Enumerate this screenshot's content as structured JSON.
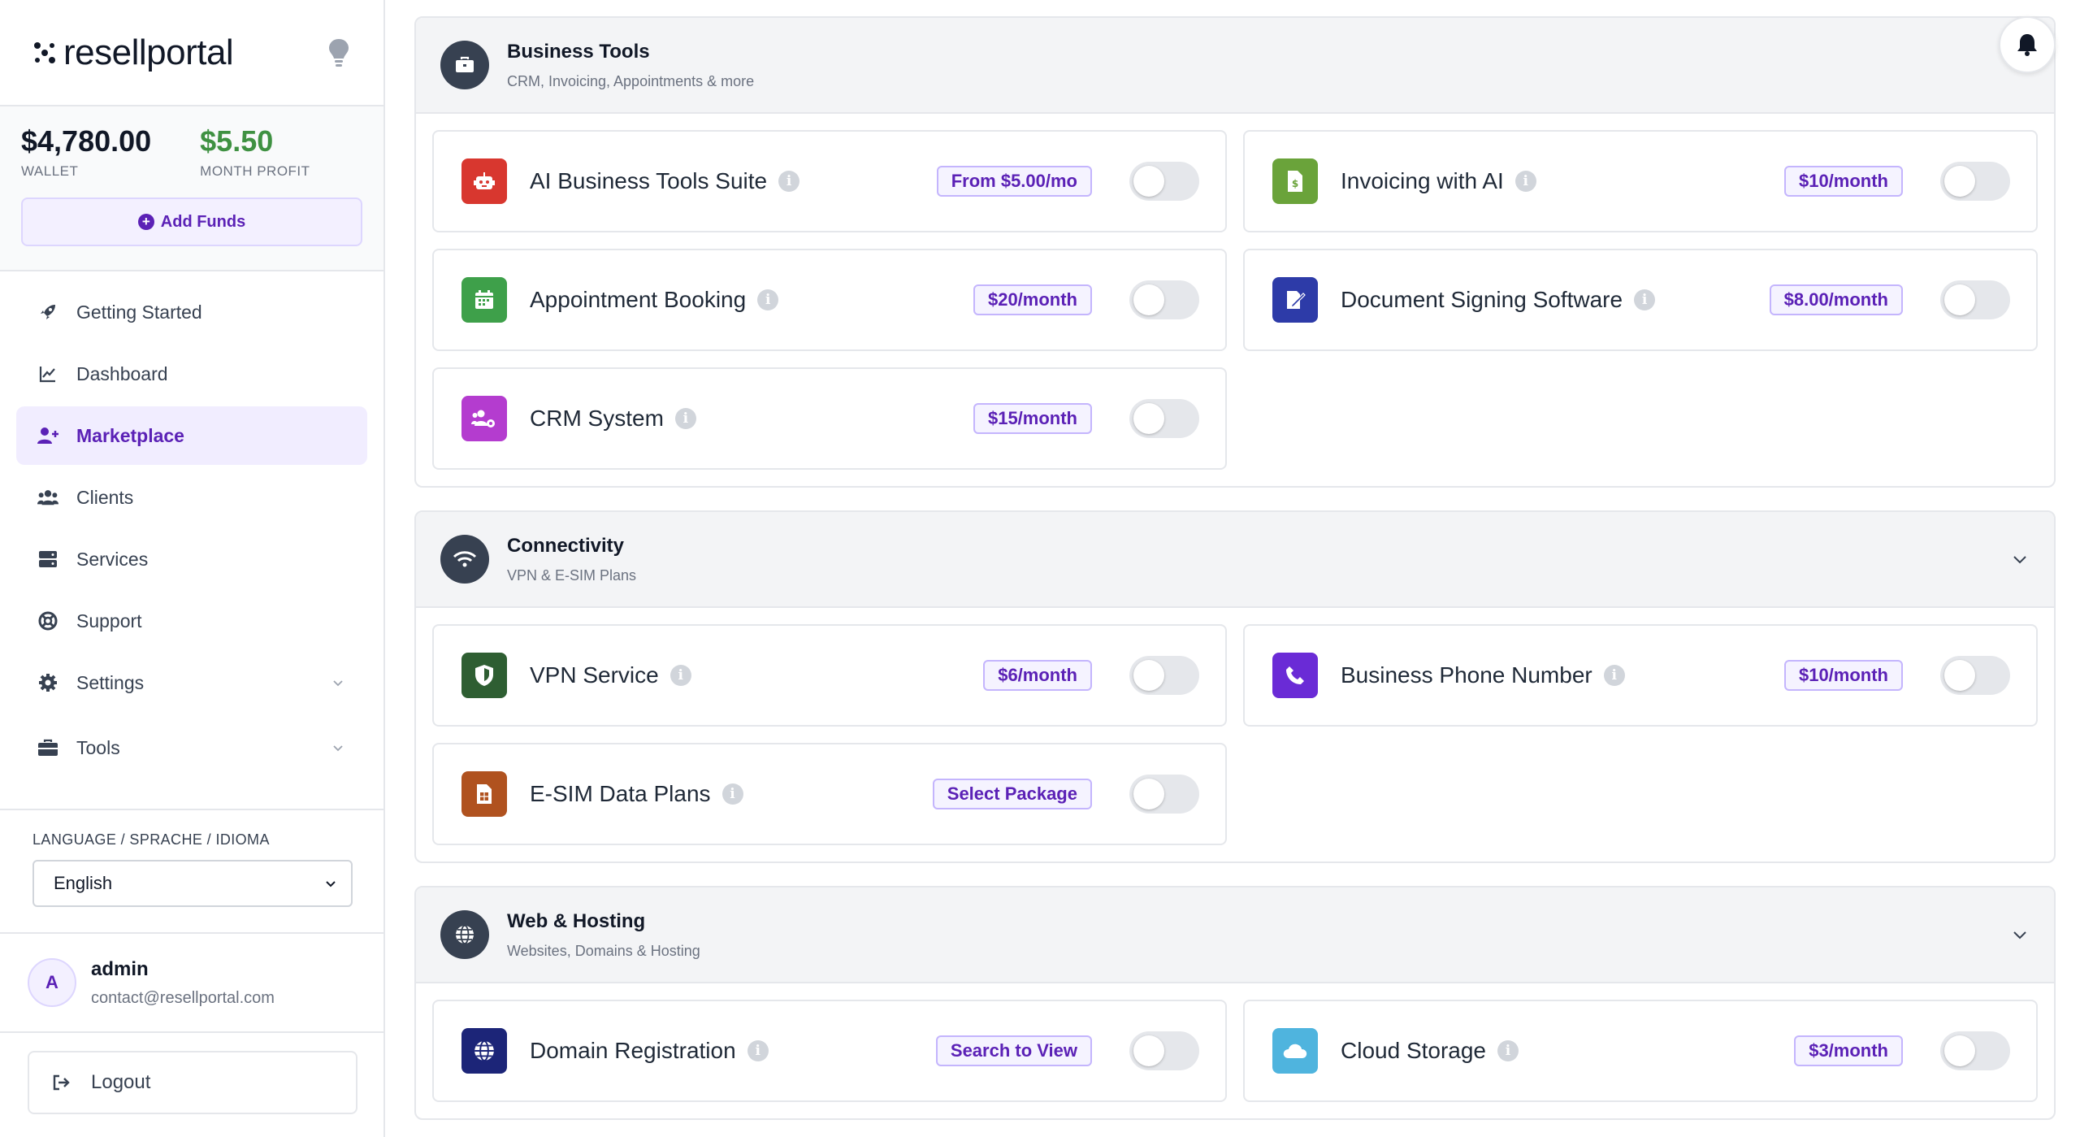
{
  "brand": {
    "name": "resellportal"
  },
  "wallet": {
    "balance": "$4,780.00",
    "balance_label": "WALLET",
    "profit": "$5.50",
    "profit_label": "MONTH PROFIT",
    "add_funds_label": "Add Funds"
  },
  "nav": {
    "items": [
      {
        "label": "Getting Started",
        "icon": "rocket-icon"
      },
      {
        "label": "Dashboard",
        "icon": "chart-line-icon"
      },
      {
        "label": "Marketplace",
        "icon": "user-plus-icon",
        "active": true
      },
      {
        "label": "Clients",
        "icon": "users-icon"
      },
      {
        "label": "Services",
        "icon": "server-icon"
      },
      {
        "label": "Support",
        "icon": "lifebuoy-icon"
      },
      {
        "label": "Settings",
        "icon": "gear-icon"
      },
      {
        "label": "Tools",
        "icon": "toolbox-icon"
      }
    ]
  },
  "language": {
    "label": "LANGUAGE / SPRACHE / IDIOMA",
    "selected": "English"
  },
  "user": {
    "initial": "A",
    "name": "admin",
    "email": "contact@resellportal.com"
  },
  "logout_label": "Logout",
  "sections": [
    {
      "title": "Business Tools",
      "subtitle": "CRM, Invoicing, Appointments & more",
      "icon": "briefcase-icon",
      "cards": [
        {
          "name": "AI Business Tools Suite",
          "price": "From $5.00/mo",
          "icon": "robot-icon",
          "color": "#d8372f"
        },
        {
          "name": "Invoicing with AI",
          "price": "$10/month",
          "icon": "invoice-icon",
          "color": "#6aa33a"
        },
        {
          "name": "Appointment Booking",
          "price": "$20/month",
          "icon": "calendar-icon",
          "color": "#3ea04a"
        },
        {
          "name": "Document Signing Software",
          "price": "$8.00/month",
          "icon": "signature-icon",
          "color": "#2d3ba8"
        },
        {
          "name": "CRM System",
          "price": "$15/month",
          "icon": "users-gear-icon",
          "color": "#b43ccf"
        }
      ]
    },
    {
      "title": "Connectivity",
      "subtitle": "VPN & E-SIM Plans",
      "icon": "wifi-icon",
      "cards": [
        {
          "name": "VPN Service",
          "price": "$6/month",
          "icon": "shield-icon",
          "color": "#2e5e32"
        },
        {
          "name": "Business Phone Number",
          "price": "$10/month",
          "icon": "phone-icon",
          "color": "#6a2bd6"
        },
        {
          "name": "E-SIM Data Plans",
          "price": "Select Package",
          "icon": "sim-card-icon",
          "color": "#b0521f"
        }
      ]
    },
    {
      "title": "Web & Hosting",
      "subtitle": "Websites, Domains & Hosting",
      "icon": "globe-icon",
      "cards": [
        {
          "name": "Domain Registration",
          "price": "Search to View",
          "icon": "globe-icon",
          "color": "#1c2578"
        },
        {
          "name": "Cloud Storage",
          "price": "$3/month",
          "icon": "cloud-icon",
          "color": "#4fb4de"
        }
      ]
    }
  ]
}
